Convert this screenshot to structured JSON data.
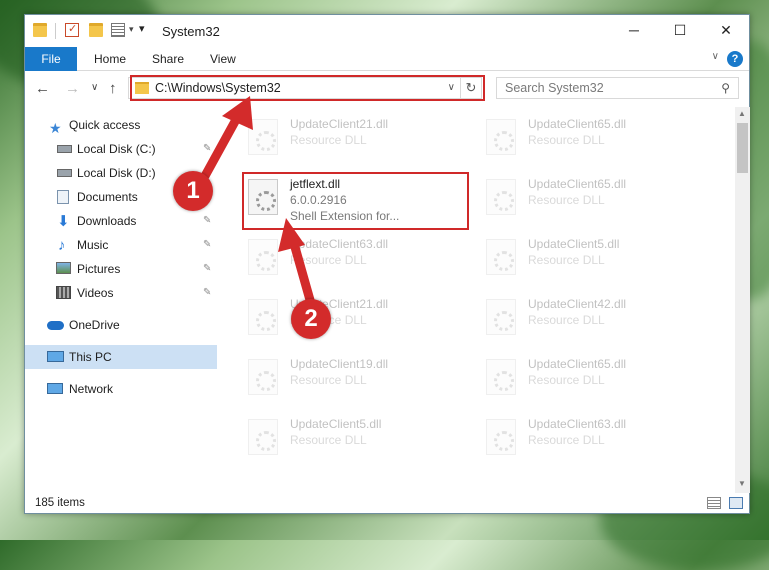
{
  "window": {
    "title": "System32",
    "minimize": "─",
    "maximize": "☐",
    "close": "✕"
  },
  "ribbon": {
    "tabs": [
      "File",
      "Home",
      "Share",
      "View"
    ],
    "help": "?"
  },
  "nav": {
    "back": "←",
    "forward": "→",
    "recent": "∨",
    "up": "↑",
    "address": "C:\\Windows\\System32",
    "refresh": "↻",
    "search_placeholder": "Search System32"
  },
  "sidebar": {
    "items": [
      {
        "label": "Quick access",
        "icon": "star-icon"
      },
      {
        "label": "Local Disk (C:)",
        "icon": "drive-icon",
        "pinned": true
      },
      {
        "label": "Local Disk (D:)",
        "icon": "drive-icon",
        "pinned": true
      },
      {
        "label": "Documents",
        "icon": "documents-icon",
        "pinned": true
      },
      {
        "label": "Downloads",
        "icon": "download-icon",
        "pinned": true
      },
      {
        "label": "Music",
        "icon": "music-icon",
        "pinned": true
      },
      {
        "label": "Pictures",
        "icon": "pictures-icon",
        "pinned": true
      },
      {
        "label": "Videos",
        "icon": "videos-icon",
        "pinned": true
      },
      {
        "label": "OneDrive",
        "icon": "cloud-icon"
      },
      {
        "label": "This PC",
        "icon": "computer-icon",
        "selected": true
      },
      {
        "label": "Network",
        "icon": "network-icon"
      }
    ]
  },
  "files": {
    "left": [
      {
        "name": "UpdateClient21.dll",
        "type": "Resource DLL"
      },
      {
        "name": "jetflext.dll",
        "version": "6.0.0.2916",
        "desc": "Shell Extension for..."
      },
      {
        "name": "UpdateClient63.dll",
        "type": "Resource DLL"
      },
      {
        "name": "UpdateClient21.dll",
        "type": "Resource DLL"
      },
      {
        "name": "UpdateClient19.dll",
        "type": "Resource DLL"
      },
      {
        "name": "UpdateClient5.dll",
        "type": "Resource DLL"
      }
    ],
    "right": [
      {
        "name": "UpdateClient65.dll",
        "type": "Resource DLL"
      },
      {
        "name": "UpdateClient65.dll",
        "type": "Resource DLL"
      },
      {
        "name": "UpdateClient5.dll",
        "type": "Resource DLL"
      },
      {
        "name": "UpdateClient42.dll",
        "type": "Resource DLL"
      },
      {
        "name": "UpdateClient65.dll",
        "type": "Resource DLL"
      },
      {
        "name": "UpdateClient63.dll",
        "type": "Resource DLL"
      }
    ]
  },
  "status": {
    "count": "185 items"
  },
  "callouts": [
    "1",
    "2"
  ],
  "colors": {
    "accent": "#1979ca",
    "callout": "#d32b2b",
    "selection": "#cce0f4"
  }
}
